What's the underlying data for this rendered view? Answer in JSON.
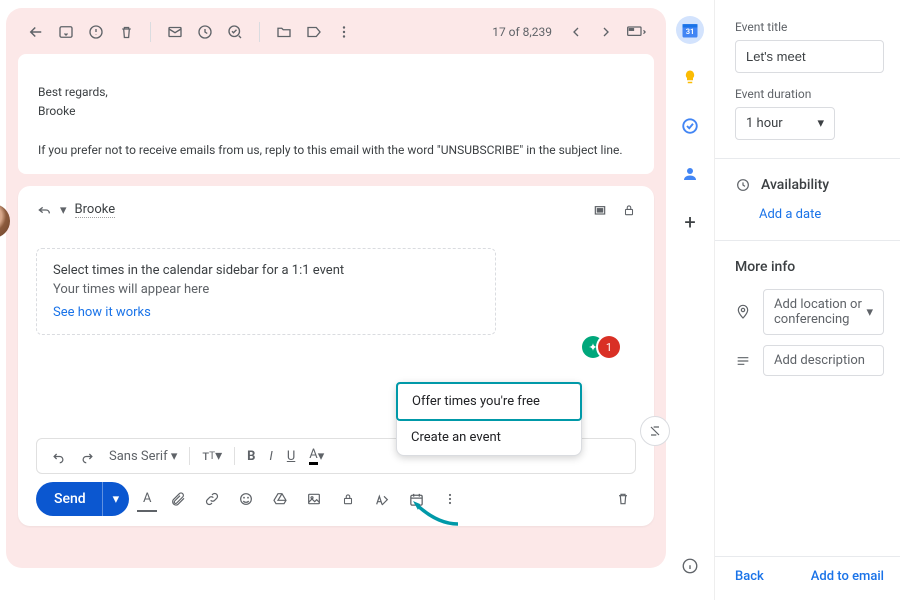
{
  "toolbar": {
    "counter": "17 of 8,239"
  },
  "email": {
    "signoff": "Best regards,",
    "sender": "Brooke",
    "unsubscribe": "If you prefer not to receive emails from us, reply to this email with the word \"UNSUBSCRIBE\" in the subject line."
  },
  "reply": {
    "arrow_label": "↩",
    "to_recipient": "Brooke",
    "hint_title": "Select times in the calendar sidebar for a 1:1 event",
    "hint_sub": "Your times will appear here",
    "hint_link": "See how it works"
  },
  "format": {
    "font_family": "Sans Serif"
  },
  "actions": {
    "send": "Send"
  },
  "popup": {
    "offer": "Offer times you're free",
    "create": "Create an event"
  },
  "badge": {
    "count": "1"
  },
  "panel": {
    "title_label": "Event title",
    "title_value": "Let's meet",
    "duration_label": "Event duration",
    "duration_value": "1 hour",
    "availability": "Availability",
    "add_date": "Add a date",
    "more_info": "More info",
    "location_placeholder": "Add location or conferencing",
    "description_placeholder": "Add description",
    "back": "Back",
    "add_to_email": "Add to email"
  }
}
